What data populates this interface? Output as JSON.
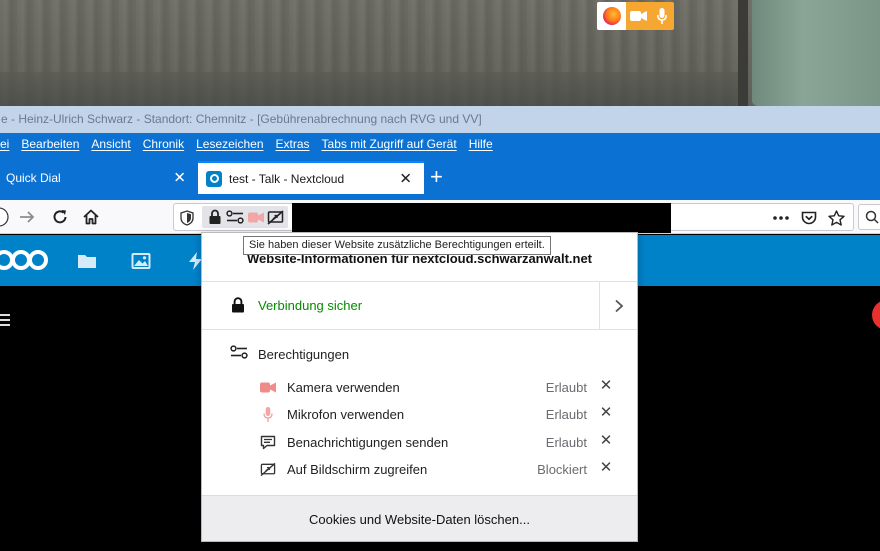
{
  "window": {
    "title": "e - Heinz-Ulrich Schwarz - Standort: Chemnitz - [Gebührenabrechnung nach RVG und VV]"
  },
  "menubar": {
    "items": [
      "ei",
      "Bearbeiten",
      "Ansicht",
      "Chronik",
      "Lesezeichen",
      "Extras",
      "Tabs mit Zugriff auf Gerät",
      "Hilfe"
    ]
  },
  "tabs": [
    {
      "label": "Quick Dial",
      "active": false
    },
    {
      "label": "test - Talk - Nextcloud",
      "active": true
    }
  ],
  "tooltip": "Sie haben dieser Website zusätzliche Berechtigungen erteilt.",
  "panel": {
    "title": "Website-Informationen für nextcloud.schwarzanwalt.net",
    "connection": "Verbindung sicher",
    "permissions_heading": "Berechtigungen",
    "permissions": [
      {
        "label": "Kamera verwenden",
        "state": "Erlaubt",
        "icon": "camera-icon"
      },
      {
        "label": "Mikrofon verwenden",
        "state": "Erlaubt",
        "icon": "microphone-icon"
      },
      {
        "label": "Benachrichtigungen senden",
        "state": "Erlaubt",
        "icon": "notification-icon"
      },
      {
        "label": "Auf Bildschirm zugreifen",
        "state": "Blockiert",
        "icon": "screen-share-blocked-icon"
      }
    ],
    "footer": "Cookies und Website-Daten löschen..."
  },
  "colors": {
    "accent_blue": "#0b72d4",
    "nextcloud_blue": "#0082c9",
    "secure_green": "#058b00",
    "sharing_orange": "#f5a732",
    "permission_icon_red": "#f08b8b"
  }
}
